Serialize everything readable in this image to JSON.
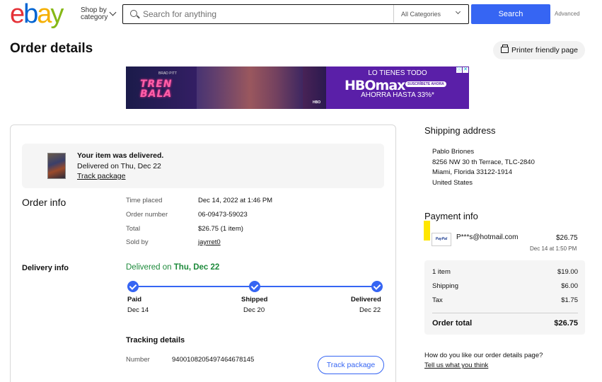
{
  "header": {
    "logo_letters": [
      "e",
      "b",
      "a",
      "y"
    ],
    "shop_by_line1": "Shop by",
    "shop_by_line2": "category",
    "search_placeholder": "Search for anything",
    "category_selected": "All Categories",
    "search_button": "Search",
    "advanced_link": "Advanced"
  },
  "page": {
    "title": "Order details",
    "print_button": "Printer friendly page"
  },
  "ad": {
    "left_title_line1": "TREN",
    "left_title_line2": "BALA",
    "left_tag": "BRAD PITT",
    "left_badge": "HBO",
    "right_line1": "LO TIENES TODO",
    "right_brand": "HBOmax",
    "right_subscribe": "SUSCRÍBETE AHORA",
    "right_line3": "AHORRA HASTA 33%*",
    "info_icon": "ⓘ",
    "close_icon": "✕"
  },
  "delivery_banner": {
    "status": "Your item was delivered.",
    "date": "Delivered on Thu, Dec 22",
    "track_link": "Track package"
  },
  "order_info": {
    "heading": "Order info",
    "rows": [
      {
        "label": "Time placed",
        "value": "Dec 14, 2022 at 1:46 PM"
      },
      {
        "label": "Order number",
        "value": "06-09473-59023"
      },
      {
        "label": "Total",
        "value": "$26.75 (1 item)"
      },
      {
        "label": "Sold by",
        "value": "jayrret0"
      }
    ]
  },
  "delivery_info": {
    "heading": "Delivery info",
    "delivered_prefix": "Delivered on ",
    "delivered_date": "Thu, Dec 22",
    "steps": [
      {
        "label": "Paid",
        "date": "Dec 14"
      },
      {
        "label": "Shipped",
        "date": "Dec 20"
      },
      {
        "label": "Delivered",
        "date": "Dec 22"
      }
    ],
    "progress": 1.0
  },
  "tracking": {
    "heading": "Tracking details",
    "number_label": "Number",
    "number_value": "9400108205497464678145",
    "track_button": "Track package"
  },
  "shipping": {
    "heading": "Shipping address",
    "lines": [
      "Pablo Briones",
      "8256 NW 30 th Terrace, TLC-2840",
      "Miami, Florida 33122-1914",
      "United States"
    ]
  },
  "payment": {
    "heading": "Payment info",
    "method_badge": "PayPal",
    "account": "P***s@hotmail.com",
    "amount": "$26.75",
    "date": "Dec 14 at 1:50 PM"
  },
  "summary": {
    "rows": [
      {
        "label": "1 item",
        "value": "$19.00"
      },
      {
        "label": "Shipping",
        "value": "$6.00"
      },
      {
        "label": "Tax",
        "value": "$1.75"
      }
    ],
    "total_label": "Order total",
    "total_value": "$26.75"
  },
  "feedback": {
    "question": "How do you like our order details page?",
    "link": "Tell us what you think"
  },
  "colors": {
    "accent": "#3665f3",
    "success": "#1d8a3b",
    "highlight": "#ffe600"
  }
}
